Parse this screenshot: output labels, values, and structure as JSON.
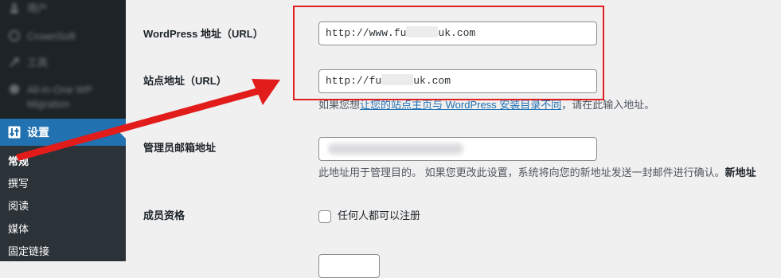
{
  "sidebar": {
    "blurred_items": [
      {
        "icon": "user-icon",
        "label": "用户"
      },
      {
        "icon": "plugin-icon",
        "label": "CrownSoft"
      },
      {
        "icon": "wrench-icon",
        "label": "工具"
      },
      {
        "icon": "migration-icon",
        "label": "All-in-One WP Migration"
      }
    ],
    "settings": {
      "icon": "settings-icon",
      "label": "设置"
    },
    "submenu": [
      "常规",
      "撰写",
      "阅读",
      "媒体",
      "固定链接"
    ]
  },
  "form": {
    "wordpress_url": {
      "label": "WordPress 地址（URL）",
      "value_prefix": "http://www.fu",
      "value_suffix": "uk.com"
    },
    "site_url": {
      "label": "站点地址（URL）",
      "value_prefix": "http://fu",
      "value_suffix": "uk.com"
    },
    "site_url_desc": {
      "pre": "如果您想",
      "link": "让您的站点主页与 WordPress 安装目录不同",
      "post": "，请在此输入地址。"
    },
    "admin_email": {
      "label": "管理员邮箱地址"
    },
    "admin_email_desc": {
      "text": "此地址用于管理目的。 如果您更改此设置，系统将向您的新地址发送一封邮件进行确认。",
      "bold": "新地址"
    },
    "membership": {
      "label": "成员资格",
      "checkbox_label": "任何人都可以注册"
    }
  },
  "colors": {
    "sidebar_bg": "#1d2327",
    "submenu_bg": "#2c3338",
    "accent": "#2271b1",
    "annotation_red": "#e02020"
  }
}
